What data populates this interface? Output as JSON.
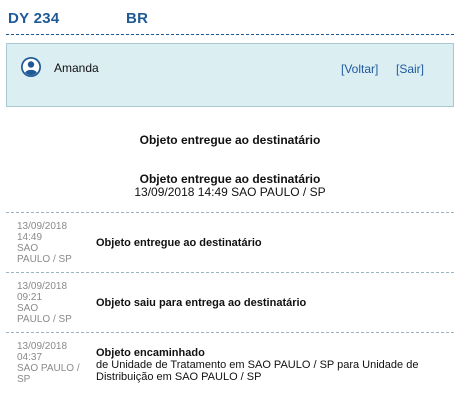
{
  "header": {
    "code": "DY 234",
    "country": "BR"
  },
  "user": {
    "name": "Amanda",
    "avatar_icon": "user-circle-icon",
    "back_link": "[Voltar]",
    "exit_link": "[Sair]"
  },
  "status": {
    "title": "Objeto entregue ao destinatário"
  },
  "summary": {
    "title": "Objeto entregue ao destinatário",
    "detail": "13/09/2018 14:49 SAO PAULO / SP"
  },
  "events": [
    {
      "date": "13/09/2018",
      "time": "14:49",
      "city": "SAO",
      "city2": "PAULO / SP",
      "title": "Objeto entregue ao destinatário",
      "detail": ""
    },
    {
      "date": "13/09/2018",
      "time": "09:21",
      "city": "SAO",
      "city2": "PAULO / SP",
      "title": "Objeto saiu para entrega ao destinatário",
      "detail": ""
    },
    {
      "date": "13/09/2018",
      "time": "04:37",
      "city": "SAO PAULO /",
      "city2": "SP",
      "title": "Objeto encaminhado",
      "detail": "de Unidade de Tratamento em SAO PAULO / SP para Unidade de Distribuição em SAO PAULO / SP"
    }
  ],
  "colors": {
    "accent": "#1f5a96",
    "user_box_bg": "#dbeef2",
    "link": "#1f5aa0"
  }
}
